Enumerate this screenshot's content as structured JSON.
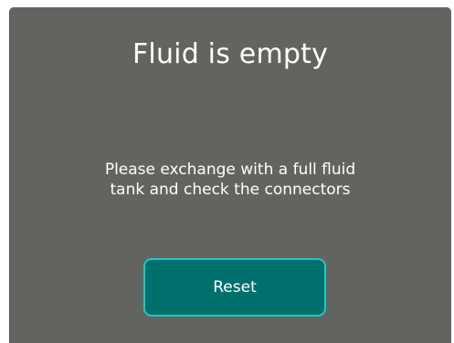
{
  "dialog": {
    "title": "Fluid is empty",
    "message_line_1": "Please exchange with a full fluid",
    "message_line_2": "tank and check the connectors",
    "reset_label": "Reset"
  },
  "colors": {
    "dialog_background": "#626460",
    "button_background": "#00706d",
    "button_border": "#22c7c6",
    "text": "#ffffff"
  }
}
